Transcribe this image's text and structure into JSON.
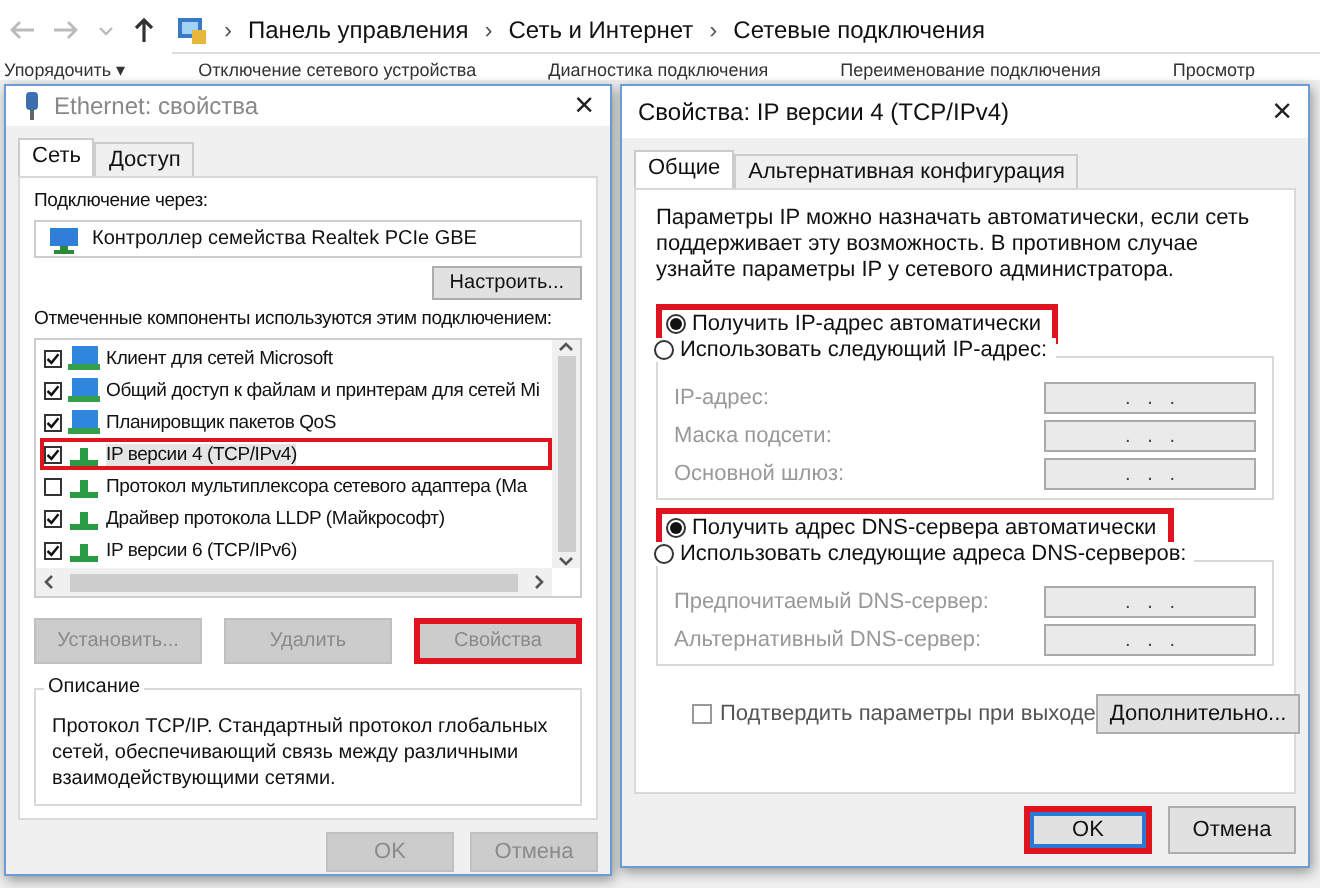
{
  "explorer": {
    "breadcrumbs": [
      "Панель управления",
      "Сеть и Интернет",
      "Сетевые подключения"
    ],
    "separator": "›",
    "toolbar": [
      "Упорядочить ▾",
      "Отключение сетевого устройства",
      "Диагностика подключения",
      "Переименование подключения",
      "Просмотр"
    ]
  },
  "ethernet_dialog": {
    "title": "Ethernet: свойства",
    "close": "×",
    "tabs": [
      {
        "label": "Сеть",
        "selected": true
      },
      {
        "label": "Доступ",
        "selected": false
      }
    ],
    "connect_label": "Подключение через:",
    "adapter": "Контроллер семейства Realtek PCIe GBE",
    "configure_button": "Настроить...",
    "components_label": "Отмеченные компоненты используются этим подключением:",
    "components": [
      {
        "kind": "client",
        "label": "Клиент для сетей Microsoft",
        "checked": true,
        "selected": false,
        "highlighted": false
      },
      {
        "kind": "client",
        "label": "Общий доступ к файлам и принтерам для сетей Mi",
        "checked": true,
        "selected": false,
        "highlighted": false
      },
      {
        "kind": "client",
        "label": "Планировщик пакетов QoS",
        "checked": true,
        "selected": false,
        "highlighted": false
      },
      {
        "kind": "protocol",
        "label": "IP версии 4 (TCP/IPv4)",
        "checked": true,
        "selected": true,
        "highlighted": true
      },
      {
        "kind": "protocol",
        "label": "Протокол мультиплексора сетевого адаптера (Ма",
        "checked": false,
        "selected": false,
        "highlighted": false
      },
      {
        "kind": "protocol",
        "label": "Драйвер протокола LLDP (Майкрософт)",
        "checked": true,
        "selected": false,
        "highlighted": false
      },
      {
        "kind": "protocol",
        "label": "IP версии 6 (TCP/IPv6)",
        "checked": true,
        "selected": false,
        "highlighted": false
      }
    ],
    "action_buttons": [
      {
        "label": "Установить...",
        "disabled": true,
        "highlighted": false
      },
      {
        "label": "Удалить",
        "disabled": true,
        "highlighted": false
      },
      {
        "label": "Свойства",
        "disabled": true,
        "highlighted": true
      }
    ],
    "description_title": "Описание",
    "description": "Протокол TCP/IP. Стандартный протокол глобальных сетей, обеспечивающий связь между различными взаимодействующими сетями.",
    "buttons": [
      {
        "label": "OK",
        "disabled": true,
        "highlighted": false
      },
      {
        "label": "Отмена",
        "disabled": true,
        "highlighted": false
      }
    ]
  },
  "ipv4_dialog": {
    "title": "Свойства: IP версии 4 (TCP/IPv4)",
    "close": "×",
    "tabs": [
      {
        "label": "Общие",
        "selected": true
      },
      {
        "label": "Альтернативная конфигурация",
        "selected": false
      }
    ],
    "intro": "Параметры IP можно назначать автоматически, если сеть поддерживает эту возможность. В противном случае узнайте параметры IP у сетевого администратора.",
    "sections": [
      {
        "auto": {
          "label": "Получить IP-адрес автоматически",
          "selected": true,
          "highlighted": true
        },
        "manual": {
          "label": "Использовать следующий IP-адрес:",
          "selected": false
        },
        "fields": [
          {
            "label": "IP-адрес:",
            "value": ".   .   .",
            "disabled": true
          },
          {
            "label": "Маска подсети:",
            "value": ".   .   .",
            "disabled": true
          },
          {
            "label": "Основной шлюз:",
            "value": ".   .   .",
            "disabled": true
          }
        ]
      },
      {
        "auto": {
          "label": "Получить адрес DNS-сервера автоматически",
          "selected": true,
          "highlighted": true
        },
        "manual": {
          "label": "Использовать следующие адреса DNS-серверов:",
          "selected": false
        },
        "fields": [
          {
            "label": "Предпочитаемый DNS-сервер:",
            "value": ".   .   .",
            "disabled": true
          },
          {
            "label": "Альтернативный DNS-сервер:",
            "value": ".   .   .",
            "disabled": true
          }
        ]
      }
    ],
    "validate": {
      "label": "Подтвердить параметры при выходе",
      "checked": false
    },
    "advanced_button": "Дополнительно...",
    "buttons": [
      {
        "label": "OK",
        "disabled": false,
        "highlighted": true
      },
      {
        "label": "Отмена",
        "disabled": false,
        "highlighted": false
      }
    ]
  }
}
